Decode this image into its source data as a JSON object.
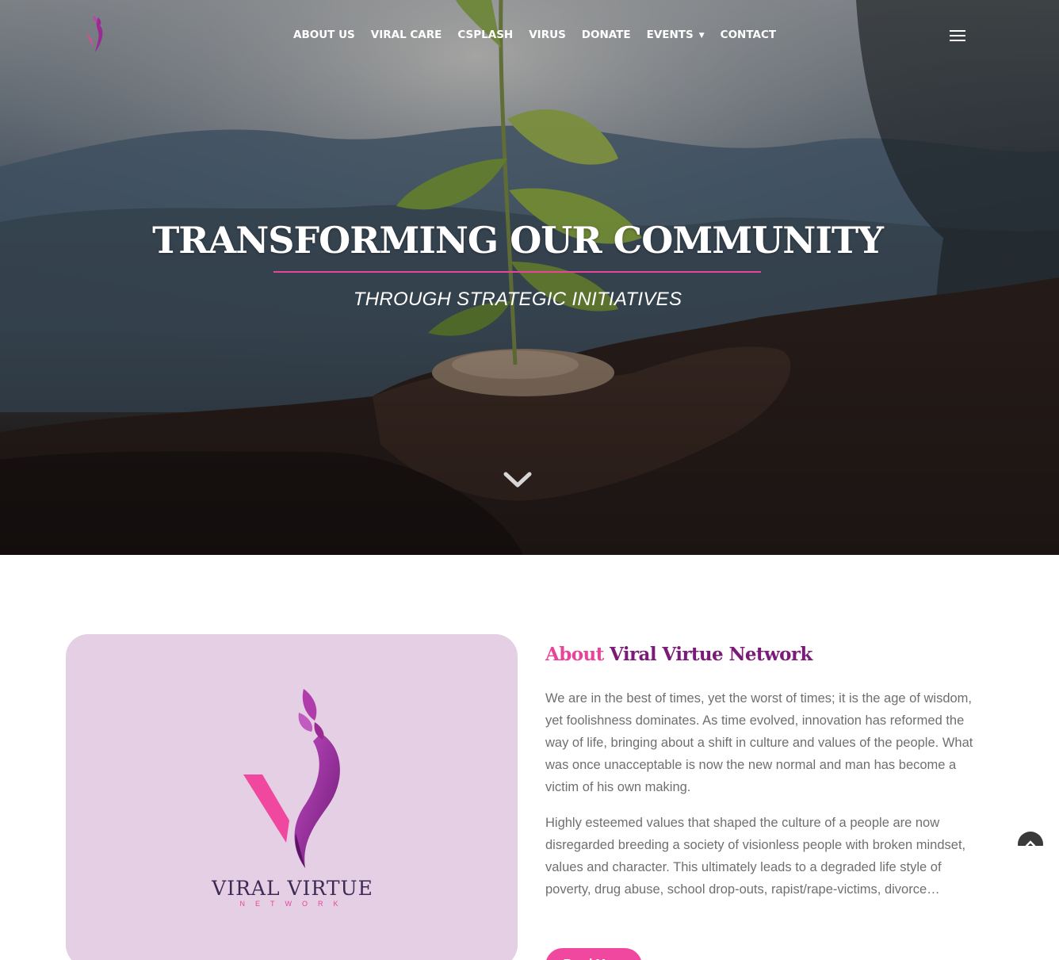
{
  "nav": {
    "items": [
      {
        "label": "ABOUT US"
      },
      {
        "label": "VIRAL CARE"
      },
      {
        "label": "CSPLASH"
      },
      {
        "label": "VIRUS"
      },
      {
        "label": "DONATE"
      },
      {
        "label": "EVENTS",
        "has_dropdown": true
      },
      {
        "label": "CONTACT"
      }
    ],
    "menu_icon": "hamburger-menu-icon"
  },
  "hero": {
    "title": "TRANSFORMING OUR COMMUNITY",
    "subtitle": "THROUGH STRATEGIC INITIATIVES",
    "scroll_icon": "chevron-down-icon"
  },
  "about": {
    "heading_accent": "About",
    "heading_main": "Viral Virtue Network",
    "brand_name": "VIRAL VIRTUE",
    "brand_sub": "NETWORK",
    "paragraph_1": "We are in the best of times, yet the worst of times; it is the age of wisdom, yet foolishness dominates. As time evolved, innovation has reformed the way of life, bringing about a shift in culture and values of the people. What was once unacceptable is now the new normal and man has become a victim of his own making.",
    "paragraph_2": "Highly esteemed values that shaped the culture of a people are now disregarded breeding a society of visionless people with broken mindset, values and character. This ultimately leads to a degraded life style of poverty, drug abuse, school drop-outs, rapist/rape-victims, divorce…",
    "read_more": "Read More"
  },
  "colors": {
    "accent_pink": "#e8449a",
    "accent_purple": "#7b1b78",
    "card_bg": "#e5cfe4"
  }
}
